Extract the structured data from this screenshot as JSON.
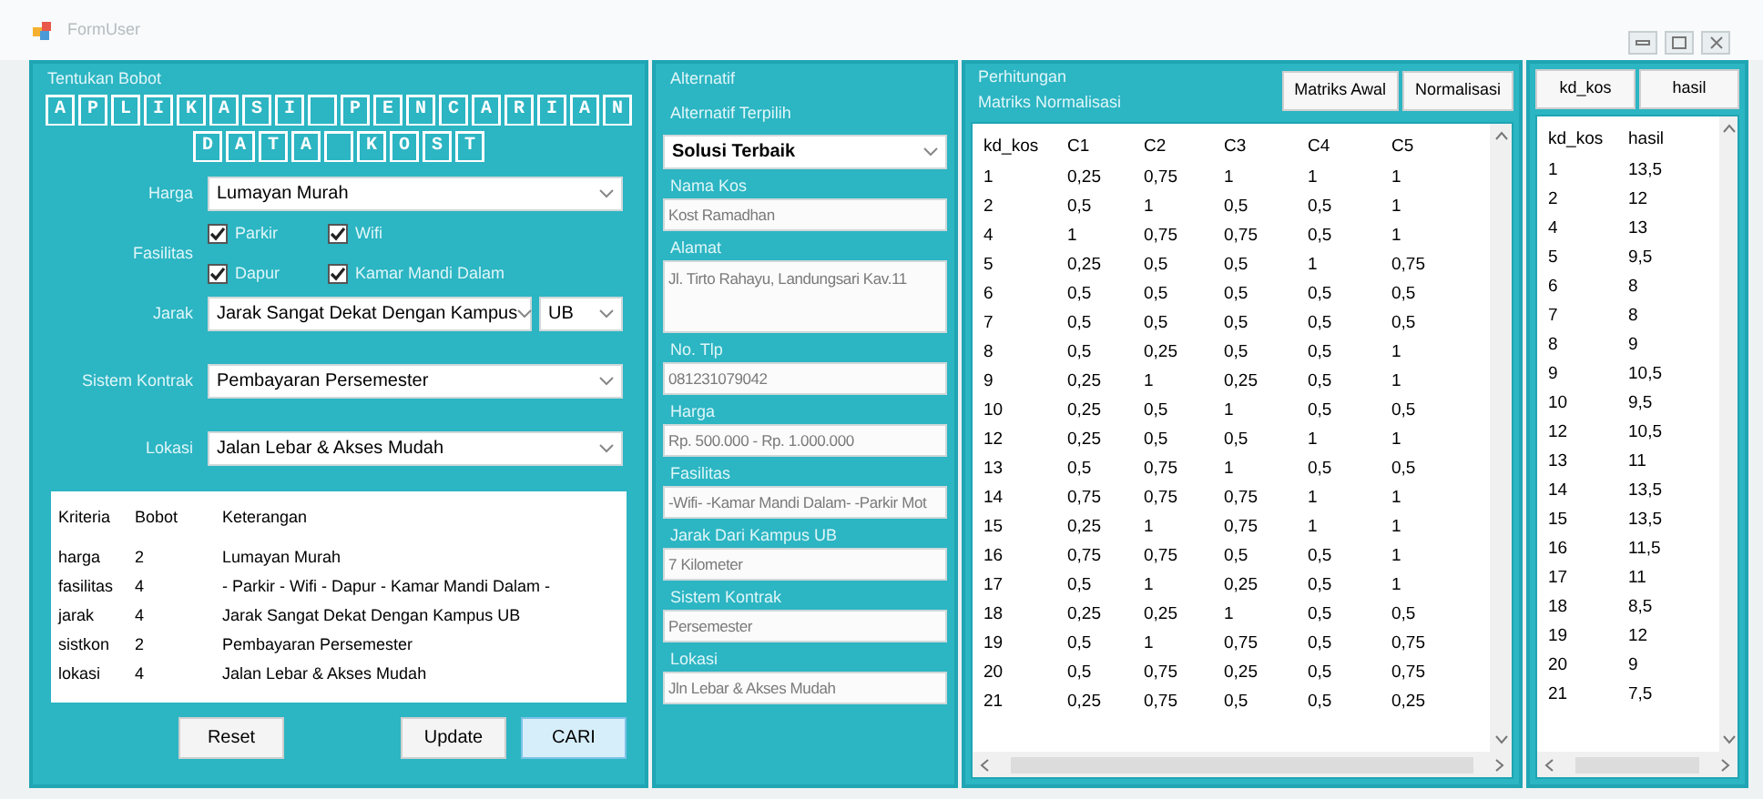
{
  "window": {
    "title": "FormUser"
  },
  "bobot_panel": {
    "legend": "Tentukan Bobot",
    "title_lines": [
      "APLIKASI PENCARIAN",
      "DATA KOST"
    ],
    "harga": {
      "label": "Harga",
      "value": "Lumayan Murah"
    },
    "fasilitas": {
      "label": "Fasilitas",
      "options": [
        {
          "label": "Parkir",
          "checked": true
        },
        {
          "label": "Wifi",
          "checked": true
        },
        {
          "label": "Dapur",
          "checked": true
        },
        {
          "label": "Kamar Mandi Dalam",
          "checked": true
        }
      ]
    },
    "jarak": {
      "label": "Jarak",
      "value": "Jarak Sangat Dekat Dengan Kampus",
      "campus": "UB"
    },
    "sistem_kontrak": {
      "label": "Sistem Kontrak",
      "value": "Pembayaran Persemester"
    },
    "lokasi": {
      "label": "Lokasi",
      "value": "Jalan Lebar & Akses Mudah"
    },
    "summary": {
      "columns": [
        "Kriteria",
        "Bobot",
        "Keterangan"
      ],
      "rows": [
        [
          "harga",
          "2",
          "Lumayan Murah"
        ],
        [
          "fasilitas",
          "4",
          "- Parkir - Wifi - Dapur - Kamar Mandi Dalam -"
        ],
        [
          "jarak",
          "4",
          "Jarak Sangat Dekat Dengan Kampus UB"
        ],
        [
          "sistkon",
          "2",
          "Pembayaran Persemester"
        ],
        [
          "lokasi",
          "4",
          "Jalan Lebar & Akses Mudah"
        ]
      ]
    },
    "buttons": [
      {
        "label": "Reset",
        "selected": false
      },
      {
        "label": "Update",
        "selected": false
      },
      {
        "label": "CARI",
        "selected": true
      }
    ]
  },
  "alternatif_panel": {
    "legend": "Alternatif",
    "select_label": "Alternatif Terpilih",
    "select_value": "Solusi Terbaik",
    "fields": [
      {
        "label": "Nama Kos",
        "value": "Kost Ramadhan",
        "kind": "line"
      },
      {
        "label": "Alamat",
        "value": "Jl. Tirto Rahayu, Landungsari Kav.11",
        "kind": "multiline"
      },
      {
        "label": "No. Tlp",
        "value": "081231079042",
        "kind": "line"
      },
      {
        "label": "Harga",
        "value": "Rp. 500.000 - Rp. 1.000.000",
        "kind": "line"
      },
      {
        "label": "Fasilitas",
        "value": "-Wifi- -Kamar Mandi Dalam- -Parkir Mot",
        "kind": "line"
      },
      {
        "label": "Jarak Dari Kampus UB",
        "value": "7 Kilometer",
        "kind": "line"
      },
      {
        "label": "Sistem Kontrak",
        "value": "Persemester",
        "kind": "line"
      },
      {
        "label": "Lokasi",
        "value": "Jln Lebar & Akses Mudah",
        "kind": "line"
      }
    ]
  },
  "perhitungan_panel": {
    "legend": "Perhitungan",
    "caption": "Matriks Normalisasi",
    "buttons": [
      "Matriks Awal",
      "Normalisasi"
    ],
    "table": {
      "columns": [
        "kd_kos",
        "C1",
        "C2",
        "C3",
        "C4",
        "C5"
      ],
      "rows": [
        [
          "1",
          "0,25",
          "0,75",
          "1",
          "1",
          "1"
        ],
        [
          "2",
          "0,5",
          "1",
          "0,5",
          "0,5",
          "1"
        ],
        [
          "4",
          "1",
          "0,75",
          "0,75",
          "0,5",
          "1"
        ],
        [
          "5",
          "0,25",
          "0,5",
          "0,5",
          "1",
          "0,75"
        ],
        [
          "6",
          "0,5",
          "0,5",
          "0,5",
          "0,5",
          "0,5"
        ],
        [
          "7",
          "0,5",
          "0,5",
          "0,5",
          "0,5",
          "0,5"
        ],
        [
          "8",
          "0,5",
          "0,25",
          "0,5",
          "0,5",
          "1"
        ],
        [
          "9",
          "0,25",
          "1",
          "0,25",
          "0,5",
          "1"
        ],
        [
          "10",
          "0,25",
          "0,5",
          "1",
          "0,5",
          "0,5"
        ],
        [
          "12",
          "0,25",
          "0,5",
          "0,5",
          "1",
          "1"
        ],
        [
          "13",
          "0,5",
          "0,75",
          "1",
          "0,5",
          "0,5"
        ],
        [
          "14",
          "0,75",
          "0,75",
          "0,75",
          "1",
          "1"
        ],
        [
          "15",
          "0,25",
          "1",
          "0,75",
          "1",
          "1"
        ],
        [
          "16",
          "0,75",
          "0,75",
          "0,5",
          "0,5",
          "1"
        ],
        [
          "17",
          "0,5",
          "1",
          "0,25",
          "0,5",
          "1"
        ],
        [
          "18",
          "0,25",
          "0,25",
          "1",
          "0,5",
          "0,5"
        ],
        [
          "19",
          "0,5",
          "1",
          "0,75",
          "0,5",
          "0,75"
        ],
        [
          "20",
          "0,5",
          "0,75",
          "0,25",
          "0,5",
          "0,75"
        ],
        [
          "21",
          "0,25",
          "0,75",
          "0,5",
          "0,5",
          "0,25"
        ]
      ]
    }
  },
  "hasil_panel": {
    "buttons": [
      "kd_kos",
      "hasil"
    ],
    "table": {
      "columns": [
        "kd_kos",
        "hasil"
      ],
      "rows": [
        [
          "1",
          "13,5"
        ],
        [
          "2",
          "12"
        ],
        [
          "4",
          "13"
        ],
        [
          "5",
          "9,5"
        ],
        [
          "6",
          "8"
        ],
        [
          "7",
          "8"
        ],
        [
          "8",
          "9"
        ],
        [
          "9",
          "10,5"
        ],
        [
          "10",
          "9,5"
        ],
        [
          "12",
          "10,5"
        ],
        [
          "13",
          "11"
        ],
        [
          "14",
          "13,5"
        ],
        [
          "15",
          "13,5"
        ],
        [
          "16",
          "11,5"
        ],
        [
          "17",
          "11"
        ],
        [
          "18",
          "8,5"
        ],
        [
          "19",
          "12"
        ],
        [
          "20",
          "9"
        ],
        [
          "21",
          "7,5"
        ]
      ]
    }
  }
}
